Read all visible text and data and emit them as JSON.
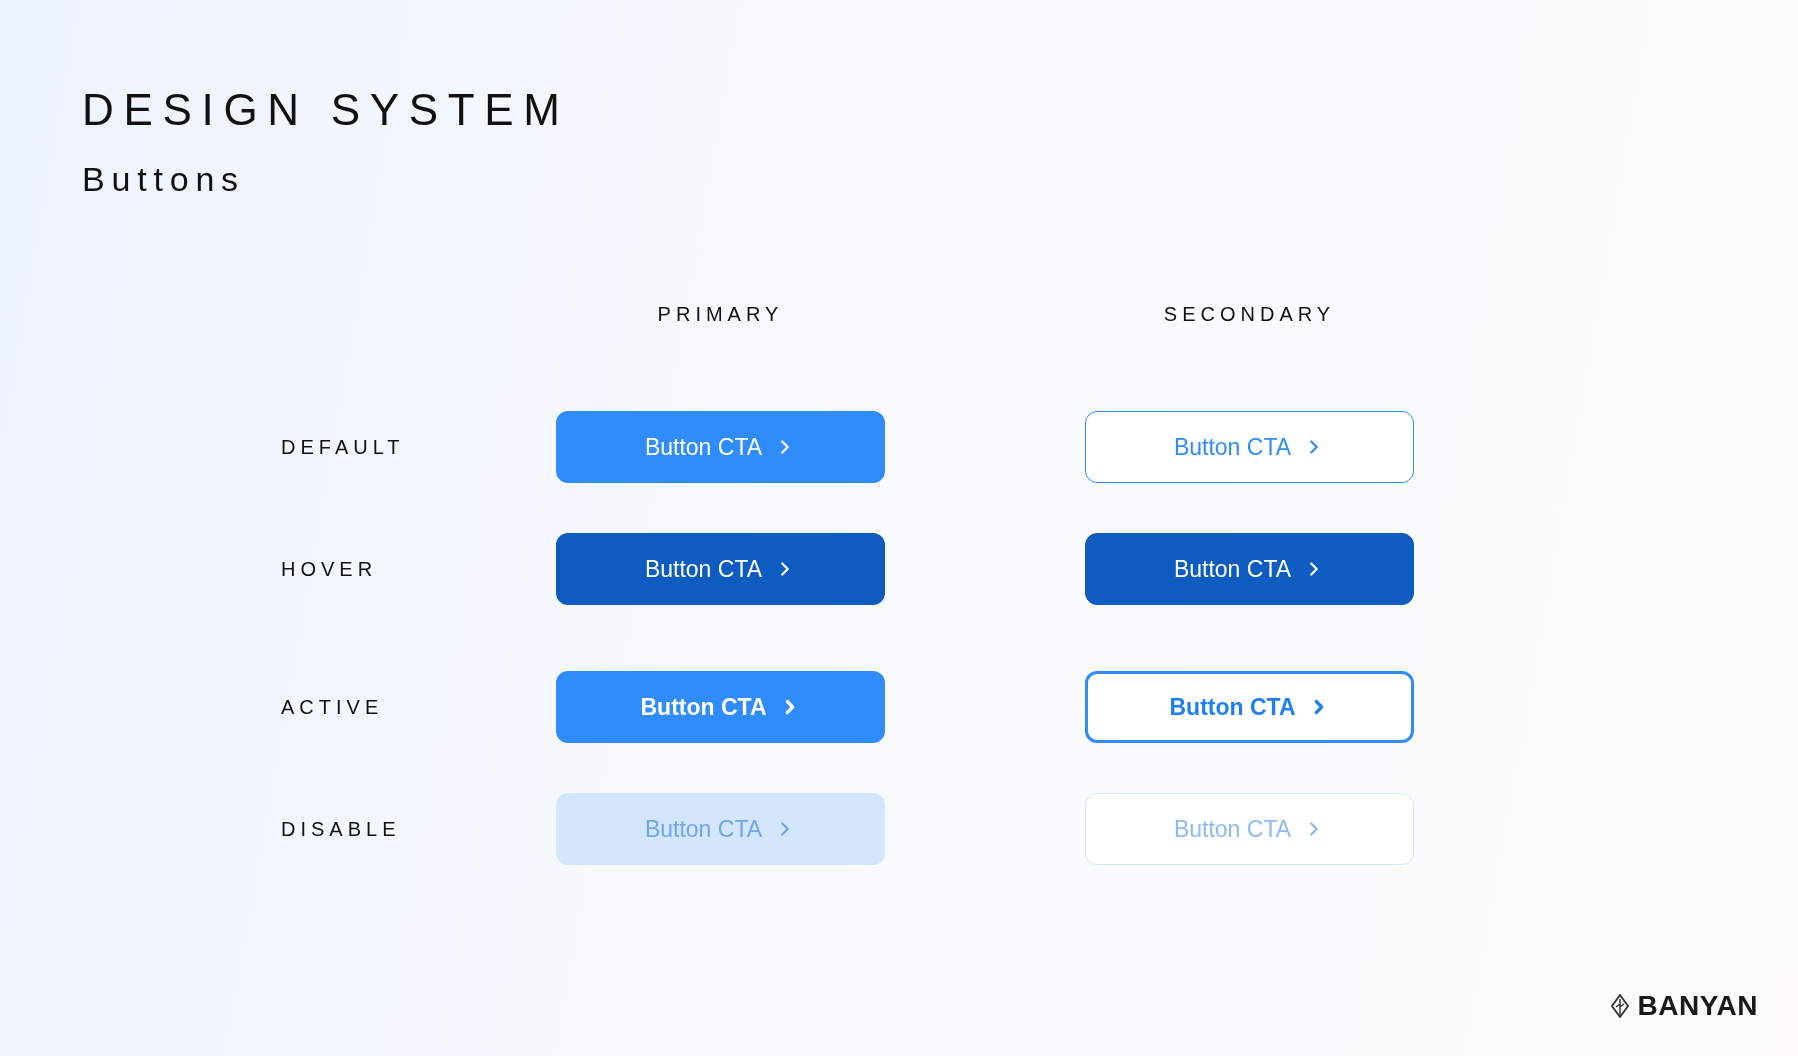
{
  "title": "DESIGN SYSTEM",
  "subtitle": "Buttons",
  "columns": [
    {
      "heading": "PRIMARY"
    },
    {
      "heading": "SECONDARY"
    }
  ],
  "rows": [
    {
      "label": "DEFAULT",
      "kind": "default",
      "buttons": [
        {
          "label": "Button CTA",
          "kind": "primary"
        },
        {
          "label": "Button CTA",
          "kind": "secondary"
        }
      ]
    },
    {
      "label": "HOVER",
      "kind": "hover",
      "buttons": [
        {
          "label": "Button CTA",
          "kind": "primary"
        },
        {
          "label": "Button CTA",
          "kind": "secondary"
        }
      ]
    },
    {
      "label": "ACTIVE",
      "kind": "active",
      "buttons": [
        {
          "label": "Button CTA",
          "kind": "primary"
        },
        {
          "label": "Button CTA",
          "kind": "secondary"
        }
      ]
    },
    {
      "label": "DISABLE",
      "kind": "disabled",
      "buttons": [
        {
          "label": "Button CTA",
          "kind": "primary"
        },
        {
          "label": "Button CTA",
          "kind": "secondary"
        }
      ]
    }
  ],
  "logo": {
    "text": "BANYAN"
  }
}
